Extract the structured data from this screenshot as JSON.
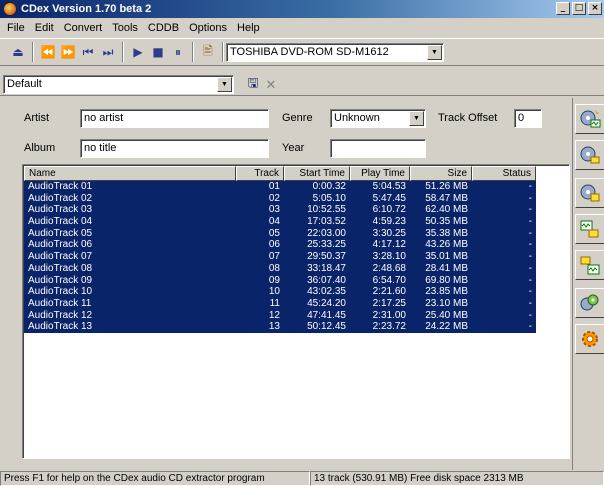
{
  "window": {
    "title": "CDex Version 1.70 beta 2",
    "minimize": "_",
    "maximize": "□",
    "close": "×"
  },
  "menu": [
    "File",
    "Edit",
    "Convert",
    "Tools",
    "CDDB",
    "Options",
    "Help"
  ],
  "toolbar": {
    "drive": "TOSHIBA DVD-ROM SD-M1612",
    "profile": "Default"
  },
  "fields": {
    "artist_label": "Artist",
    "artist_value": "no artist",
    "album_label": "Album",
    "album_value": "no title",
    "genre_label": "Genre",
    "genre_value": "Unknown",
    "year_label": "Year",
    "year_value": "",
    "track_offset_label": "Track Offset",
    "track_offset_value": "0"
  },
  "table": {
    "columns": [
      "Name",
      "Track",
      "Start Time",
      "Play Time",
      "Size",
      "Status"
    ],
    "rows": [
      [
        "AudioTrack 01",
        "01",
        "0:00.32",
        "5:04.53",
        "51.26 MB",
        "-"
      ],
      [
        "AudioTrack 02",
        "02",
        "5:05.10",
        "5:47.45",
        "58.47 MB",
        "-"
      ],
      [
        "AudioTrack 03",
        "03",
        "10:52.55",
        "6:10.72",
        "62.40 MB",
        "-"
      ],
      [
        "AudioTrack 04",
        "04",
        "17:03.52",
        "4:59.23",
        "50.35 MB",
        "-"
      ],
      [
        "AudioTrack 05",
        "05",
        "22:03.00",
        "3:30.25",
        "35.38 MB",
        "-"
      ],
      [
        "AudioTrack 06",
        "06",
        "25:33.25",
        "4:17.12",
        "43.26 MB",
        "-"
      ],
      [
        "AudioTrack 07",
        "07",
        "29:50.37",
        "3:28.10",
        "35.01 MB",
        "-"
      ],
      [
        "AudioTrack 08",
        "08",
        "33:18.47",
        "2:48.68",
        "28.41 MB",
        "-"
      ],
      [
        "AudioTrack 09",
        "09",
        "36:07.40",
        "6:54.70",
        "69.80 MB",
        "-"
      ],
      [
        "AudioTrack 10",
        "10",
        "43:02.35",
        "2:21.60",
        "23.85 MB",
        "-"
      ],
      [
        "AudioTrack 11",
        "11",
        "45:24.20",
        "2:17.25",
        "23.10 MB",
        "-"
      ],
      [
        "AudioTrack 12",
        "12",
        "47:41.45",
        "2:31.00",
        "25.40 MB",
        "-"
      ],
      [
        "AudioTrack 13",
        "13",
        "50:12.45",
        "2:23.72",
        "24.22 MB",
        "-"
      ]
    ]
  },
  "status": {
    "help": "Press F1 for help on the CDex audio CD extractor program",
    "tracks": "13 track (530.91 MB) Free disk space  2313 MB"
  },
  "colors": {
    "selection": "#0a246a",
    "title_start": "#0a246a",
    "title_end": "#a6caf0"
  }
}
